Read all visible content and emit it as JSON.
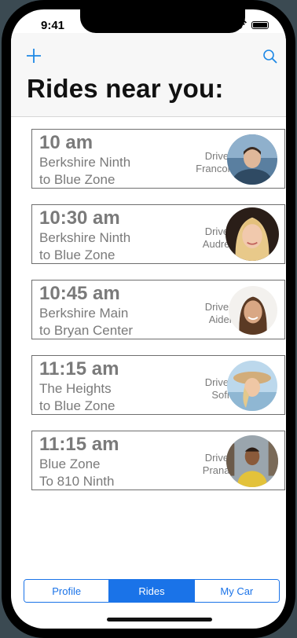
{
  "status": {
    "time": "9:41"
  },
  "header": {
    "title": "Rides near you:"
  },
  "driver_label": "Driver:",
  "rides": [
    {
      "time": "10 am",
      "route_line1": "Berkshire Ninth",
      "route_line2": "to Blue Zone",
      "driver": "Francois"
    },
    {
      "time": "10:30 am",
      "route_line1": "Berkshire Ninth",
      "route_line2": "to Blue Zone",
      "driver": "Audrey"
    },
    {
      "time": "10:45 am",
      "route_line1": "Berkshire Main",
      "route_line2": "to Bryan Center",
      "driver": "Aiden"
    },
    {
      "time": "11:15 am",
      "route_line1": "The Heights",
      "route_line2": "to Blue Zone",
      "driver": "Sofie"
    },
    {
      "time": "11:15 am",
      "route_line1": "Blue Zone",
      "route_line2": "To 810 Ninth",
      "driver": "Pranav"
    }
  ],
  "tabs": [
    {
      "label": "Profile",
      "active": false
    },
    {
      "label": "Rides",
      "active": true
    },
    {
      "label": "My Car",
      "active": false
    }
  ],
  "colors": {
    "accent": "#1a73e8",
    "card_text": "#7a7a7a"
  }
}
